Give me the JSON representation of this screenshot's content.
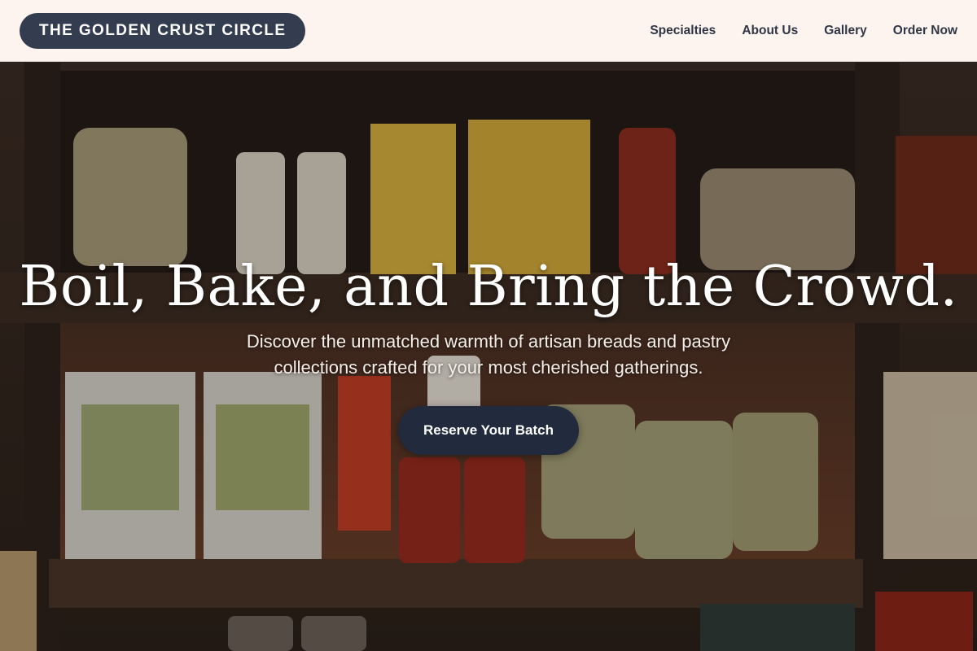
{
  "brand": {
    "name": "THE GOLDEN CRUST CIRCLE"
  },
  "nav": {
    "items": [
      {
        "label": "Specialties"
      },
      {
        "label": "About Us"
      },
      {
        "label": "Gallery"
      },
      {
        "label": "Order Now"
      }
    ]
  },
  "hero": {
    "headline": "Boil, Bake, and Bring the Crowd.",
    "subheadline": "Discover the unmatched warmth of artisan breads and pastry collections crafted for your most cherished gatherings.",
    "cta_label": "Reserve Your Batch",
    "background_image": "shelves-of-pasta-and-sauce-jars-photo"
  },
  "colors": {
    "header_bg": "#fdf4ef",
    "brand_pill": "#343c4f",
    "nav_text": "#2f3545",
    "cta_bg": "#222a3d"
  }
}
